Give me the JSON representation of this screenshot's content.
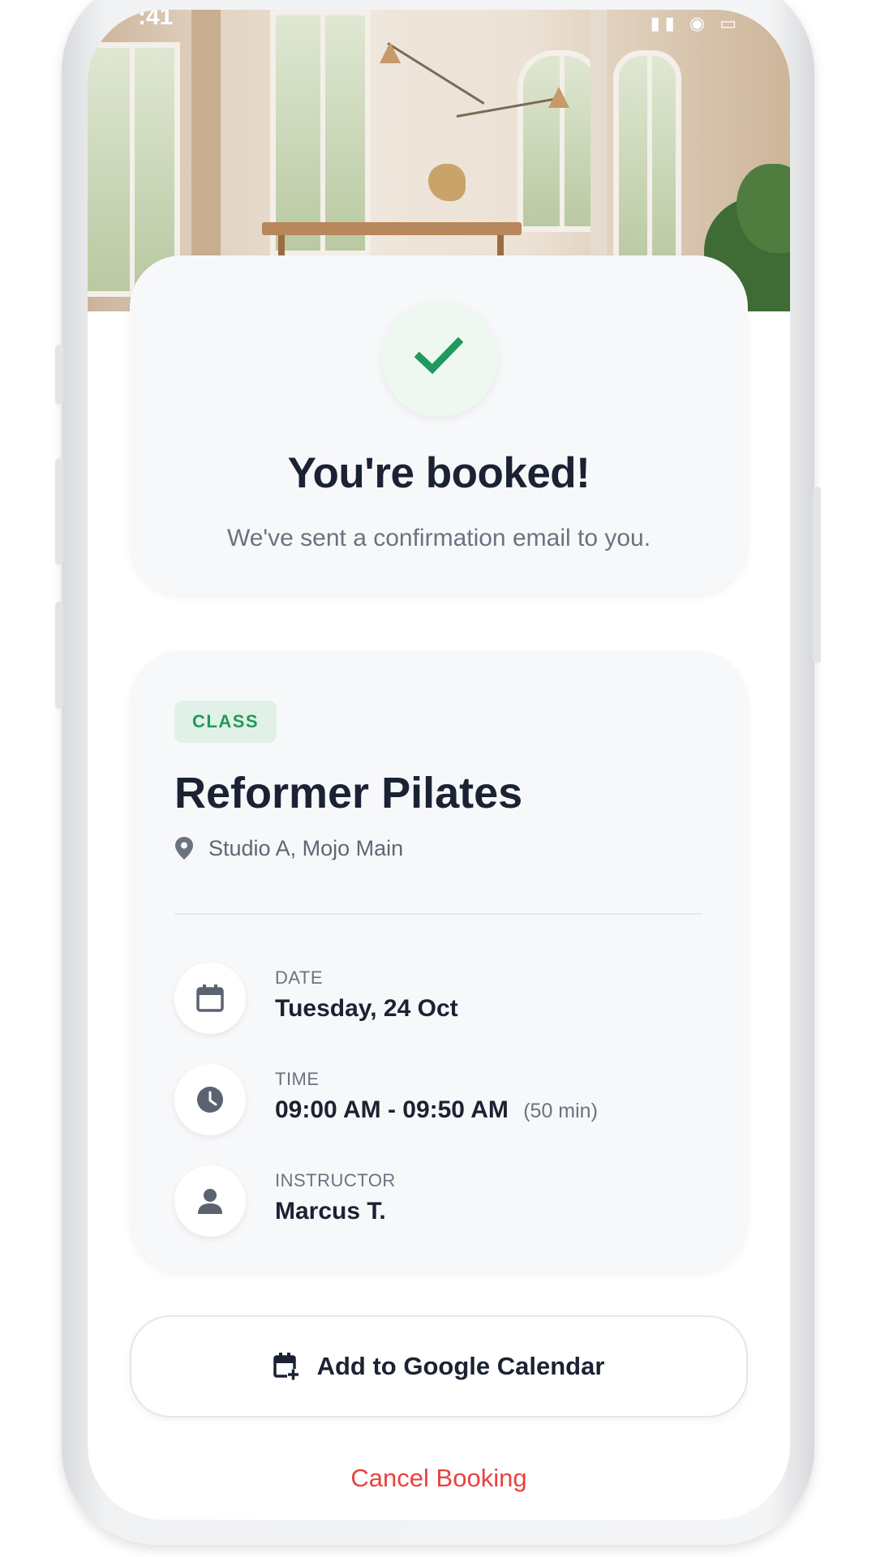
{
  "status_bar": {
    "time": ":41"
  },
  "success": {
    "title": "You're booked!",
    "message": "We've sent a confirmation email to you."
  },
  "booking": {
    "badge": "CLASS",
    "class_name": "Reformer Pilates",
    "location": "Studio A, Mojo Main",
    "details": [
      {
        "label": "DATE",
        "value": "Tuesday, 24 Oct",
        "icon": "calendar-icon"
      },
      {
        "label": "TIME",
        "value": "09:00 AM - 09:50 AM",
        "extra": "(50 min)",
        "icon": "clock-icon"
      },
      {
        "label": "INSTRUCTOR",
        "value": "Marcus T.",
        "icon": "person-icon"
      }
    ]
  },
  "actions": {
    "add_calendar_label": "Add to Google Calendar",
    "cancel_label": "Cancel Booking"
  },
  "colors": {
    "accent_green": "#1f9a5c",
    "text_dark": "#1a2233",
    "text_muted": "#6b7280",
    "danger_red": "#e8423d",
    "card_bg": "#f7f8fa"
  }
}
